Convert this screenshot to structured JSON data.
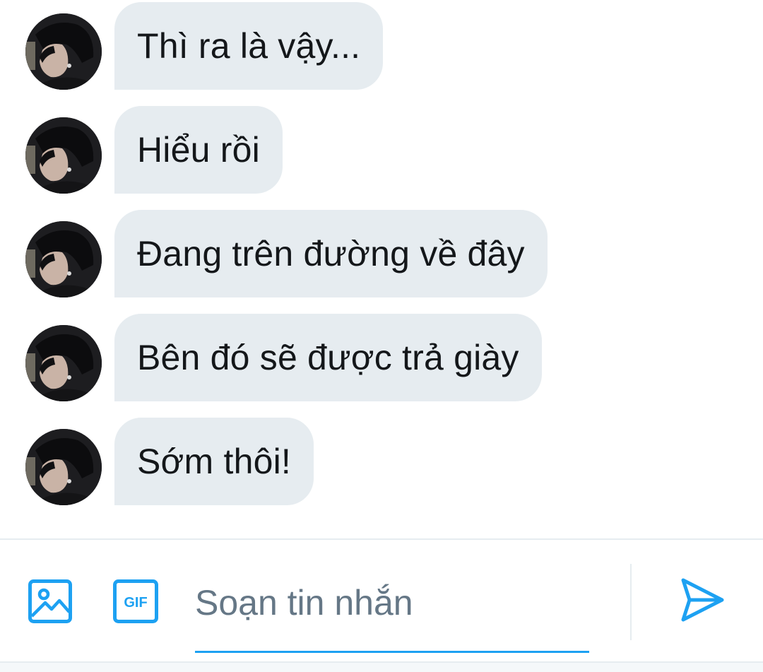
{
  "messages": [
    {
      "text": "Thì ra là vậy..."
    },
    {
      "text": "Hiểu rồi"
    },
    {
      "text": "Đang trên đường về đây"
    },
    {
      "text": "Bên đó sẽ được trả giày"
    },
    {
      "text": "Sớm thôi!"
    }
  ],
  "composer": {
    "placeholder": "Soạn tin nhắn",
    "image_icon": "image-icon",
    "gif_icon": "gif-icon",
    "gif_label": "GIF",
    "send_icon": "send-icon"
  },
  "colors": {
    "accent": "#1da1f2",
    "bubble": "#e6ecf0",
    "text": "#14171a",
    "placeholder": "#657786"
  }
}
